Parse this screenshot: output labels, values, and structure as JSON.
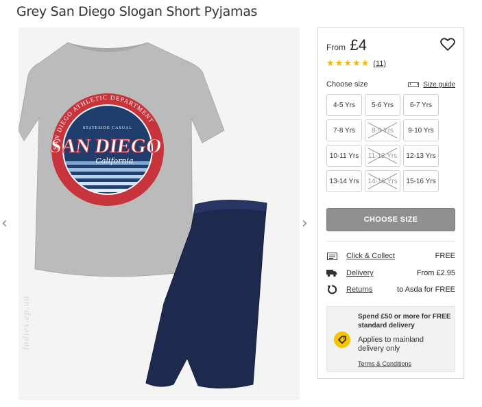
{
  "product": {
    "title": "Grey San Diego Slogan Short Pyjamas"
  },
  "gallery": {
    "prev_arrow": "‹",
    "next_arrow": "›",
    "tshirt_print": {
      "top": "STATESIDE CASUAL",
      "main": "SAN DIEGO",
      "script": "California",
      "ring": "SAN DIEGO ATHLETIC DEPARTMENT"
    },
    "watermark": "ladies.ep.ua"
  },
  "price": {
    "from_label": "From",
    "value": "£4"
  },
  "rating": {
    "stars": 5,
    "star_glyph": "★",
    "count": "(11)"
  },
  "sizes": {
    "label": "Choose size",
    "guide_label": "Size guide",
    "options": [
      {
        "label": "4-5 Yrs",
        "available": true
      },
      {
        "label": "5-6 Yrs",
        "available": true
      },
      {
        "label": "6-7 Yrs",
        "available": true
      },
      {
        "label": "7-8 Yrs",
        "available": true
      },
      {
        "label": "8-9 Yrs",
        "available": false
      },
      {
        "label": "9-10 Yrs",
        "available": true
      },
      {
        "label": "10-11 Yrs",
        "available": true
      },
      {
        "label": "11-12 Yrs",
        "available": false
      },
      {
        "label": "12-13 Yrs",
        "available": true
      },
      {
        "label": "13-14 Yrs",
        "available": true
      },
      {
        "label": "14-15 Yrs",
        "available": false
      },
      {
        "label": "15-16 Yrs",
        "available": true
      }
    ]
  },
  "cta": {
    "label": "CHOOSE SIZE"
  },
  "delivery": [
    {
      "icon": "click-collect-icon",
      "label": "Click & Collect",
      "value": "FREE"
    },
    {
      "icon": "delivery-truck-icon",
      "label": "Delivery",
      "value": "From £2.95"
    },
    {
      "icon": "returns-icon",
      "label": "Returns",
      "value": "to Asda for FREE"
    }
  ],
  "promo": {
    "headline": "Spend £50 or more for FREE standard delivery",
    "body": "Applies to mainland delivery only",
    "terms": "Terms & Conditions",
    "badge_icon": "price-tag-icon"
  },
  "colors": {
    "star": "#f4b400",
    "button": "#909090",
    "tshirt": "#b8b8b8",
    "shorts": "#1e2a4d",
    "badge": "#f6c500",
    "print_red": "#c8343b"
  }
}
